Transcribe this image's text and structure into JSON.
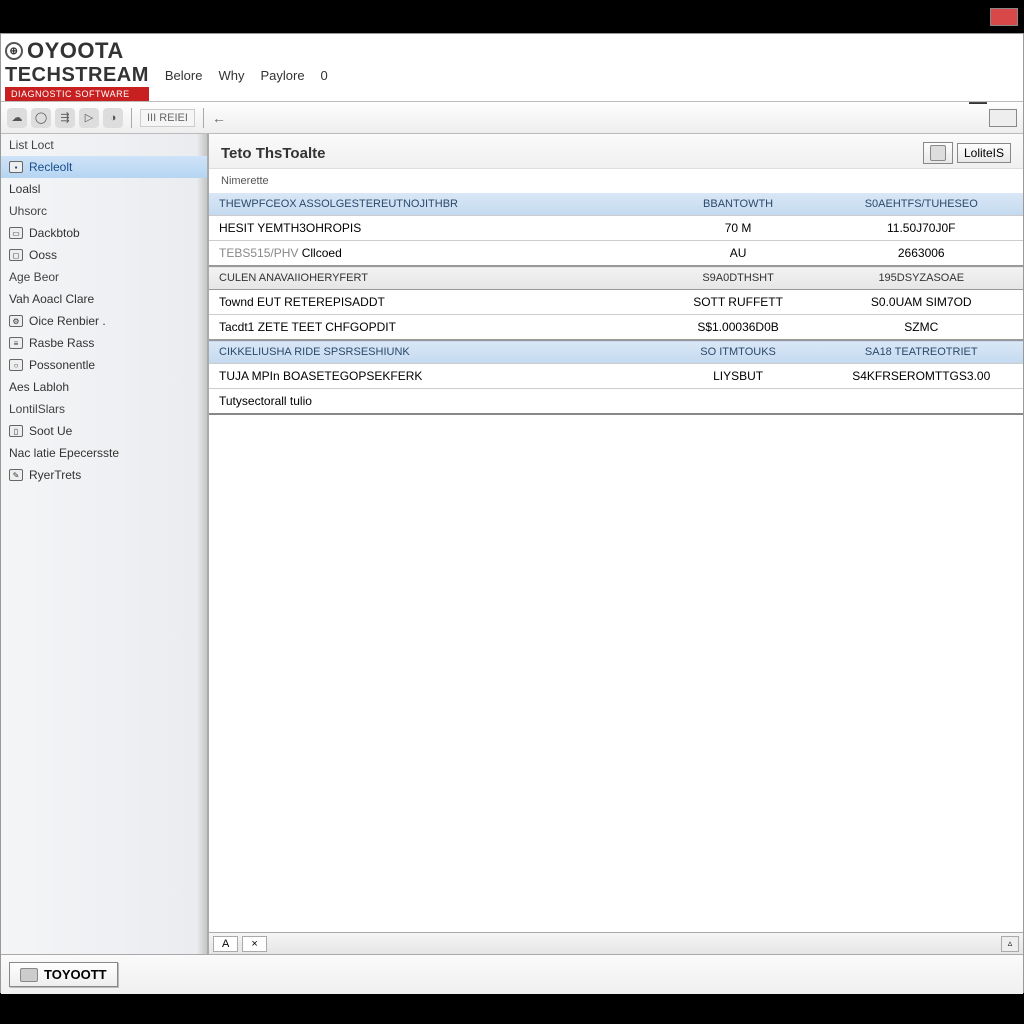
{
  "window": {
    "close": "",
    "minimize": "—"
  },
  "logo": {
    "line1": "OYOOTA",
    "line2": "TECHSTREAM",
    "tagline": "DIAGNOSTIC SOFTWARE"
  },
  "menu": {
    "item1": "Belore",
    "item2": "Why",
    "item3": "Paylore",
    "item4": "0"
  },
  "toolbar": {
    "textbtn": "III REIEI",
    "dash": "←"
  },
  "sidebar": {
    "items": [
      "List Loct",
      "Recleolt",
      "Loalsl",
      "Uhsorc",
      "Dackbtob",
      "Ooss",
      "Age Beor",
      "Vah Aoacl Clare",
      "Oice Renbier .",
      "Rasbe Rass",
      "Possonentle",
      "Aes Labloh",
      "LontilSlars",
      "Soot Ue",
      "Nac latie Epecersste",
      "RyerTrets"
    ],
    "selected_index": 1
  },
  "content": {
    "title": "Teto ThsToalte",
    "subtitle": "Nimerette",
    "header_button": "LoliteIS"
  },
  "table": {
    "header": {
      "name": "THEWPFCEOX ASSOLGESTEREUTNOJITHBR",
      "val1": "BBANTOWTH",
      "val2": "S0AEHTFS/TUHESEO"
    },
    "rows": [
      {
        "type": "data",
        "name": "HESIT YEMTH3OHROPIS",
        "val1": "70 M",
        "val2": "11.50J70J0F"
      },
      {
        "type": "muted",
        "prefix": "TEBS515/PHV",
        "name": "Cllcoed",
        "val1": "AU",
        "val2": "2663006"
      },
      {
        "type": "section",
        "name": "CULEN ANAVAIIOHERYFERT",
        "val1": "S9A0DTHSHT",
        "val2": "195DSYZASOAE"
      },
      {
        "type": "data",
        "name": "Townd EUT RETEREPISADDT",
        "val1": "SOTT RUFFETT",
        "val2": "S0.0UAM  SIM7OD"
      },
      {
        "type": "data",
        "name": "Tacdt1 ZETE TEET CHFGOPDIT",
        "val1": "S$1.00036D0B",
        "val2": "SZMC"
      },
      {
        "type": "altsection",
        "name": "CIKKELIUSHA RIDE SPSRSESHIUNK",
        "val1": "SO ITMTOUKS",
        "val2": "SA18 TEATREOTRIET"
      },
      {
        "type": "data",
        "name": "TUJA MPIn BOASETEGOPSEKFERK",
        "val1": "LIYSBUT",
        "val2": "S4KFRSEROMTTGS3.00"
      },
      {
        "type": "last",
        "name": "Tutysectorall tulio",
        "val1": "",
        "val2": ""
      }
    ]
  },
  "tabs": {
    "tab1": "A",
    "tab2": "×",
    "scroll": "▵"
  },
  "footer": {
    "button": "TOYOOTT"
  }
}
